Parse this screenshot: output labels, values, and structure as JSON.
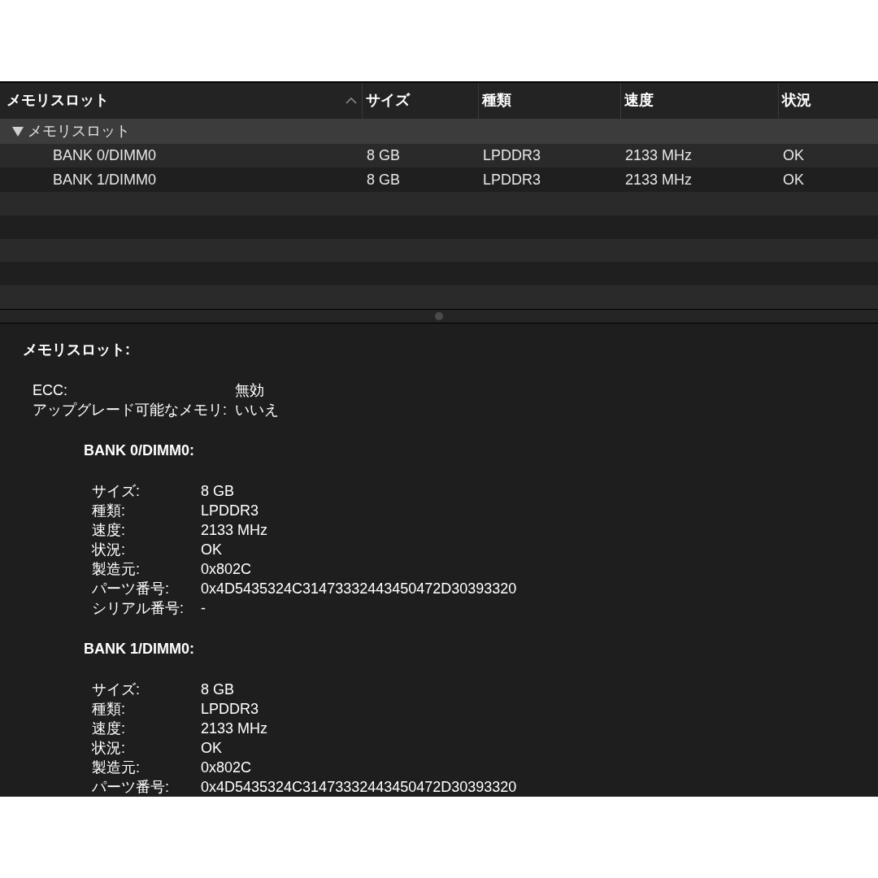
{
  "table": {
    "columns": [
      {
        "label": "メモリスロット"
      },
      {
        "label": "サイズ"
      },
      {
        "label": "種類"
      },
      {
        "label": "速度"
      },
      {
        "label": "状況"
      }
    ],
    "sort_ascending": true,
    "group": {
      "label": "メモリスロット",
      "expanded": true
    },
    "rows": [
      {
        "cells": [
          "BANK 0/DIMM0",
          "8 GB",
          "LPDDR3",
          "2133 MHz",
          "OK"
        ]
      },
      {
        "cells": [
          "BANK 1/DIMM0",
          "8 GB",
          "LPDDR3",
          "2133 MHz",
          "OK"
        ]
      }
    ]
  },
  "detail": {
    "title": "メモリスロット:",
    "summary": [
      {
        "label": "ECC:",
        "value": "無効"
      },
      {
        "label": "アップグレード可能なメモリ:",
        "value": "いいえ"
      }
    ],
    "banks": [
      {
        "title": "BANK 0/DIMM0:",
        "properties": [
          {
            "label": "サイズ:",
            "value": "8 GB"
          },
          {
            "label": "種類:",
            "value": "LPDDR3"
          },
          {
            "label": "速度:",
            "value": "2133 MHz"
          },
          {
            "label": "状況:",
            "value": "OK"
          },
          {
            "label": "製造元:",
            "value": "0x802C"
          },
          {
            "label": "パーツ番号:",
            "value": "0x4D5435324C31473332443450472D30393320"
          },
          {
            "label": "シリアル番号:",
            "value": "-"
          }
        ]
      },
      {
        "title": "BANK 1/DIMM0:",
        "properties": [
          {
            "label": "サイズ:",
            "value": "8 GB"
          },
          {
            "label": "種類:",
            "value": "LPDDR3"
          },
          {
            "label": "速度:",
            "value": "2133 MHz"
          },
          {
            "label": "状況:",
            "value": "OK"
          },
          {
            "label": "製造元:",
            "value": "0x802C"
          },
          {
            "label": "パーツ番号:",
            "value": "0x4D5435324C31473332443450472D30393320"
          }
        ]
      }
    ]
  }
}
